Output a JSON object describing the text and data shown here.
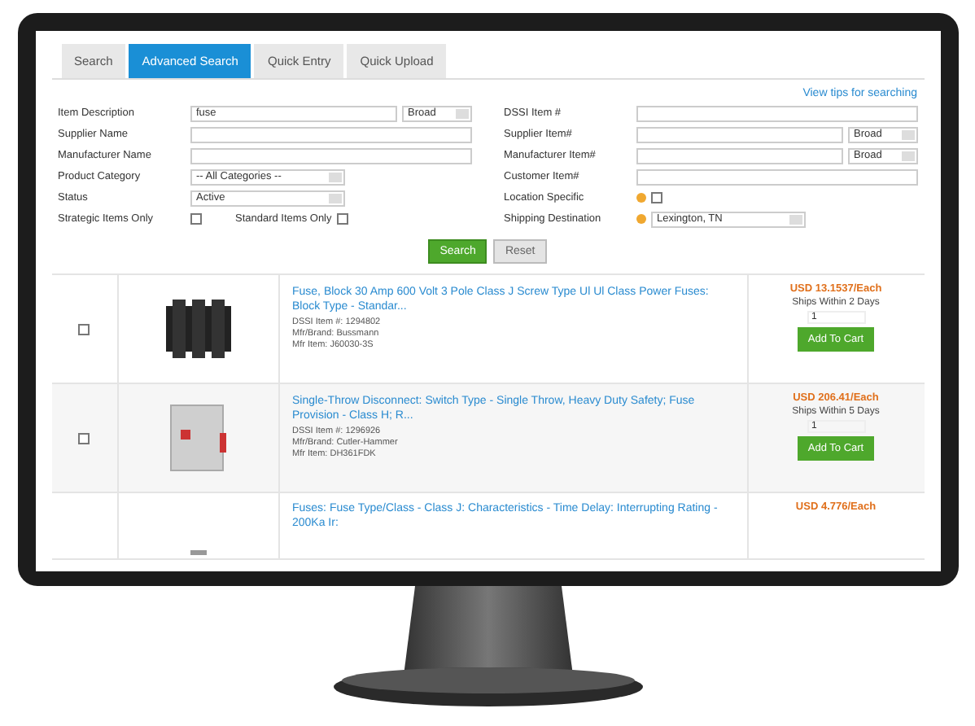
{
  "tabs": [
    {
      "label": "Search",
      "selected": false
    },
    {
      "label": "Advanced Search",
      "selected": true
    },
    {
      "label": "Quick Entry",
      "selected": false
    },
    {
      "label": "Quick Upload",
      "selected": false
    }
  ],
  "tips_link": "View tips for searching",
  "form_left": [
    {
      "kind": "text_select",
      "label": "Item Description",
      "value": "fuse",
      "option": "Broad"
    },
    {
      "kind": "text",
      "label": "Supplier Name"
    },
    {
      "kind": "text",
      "label": "Manufacturer Name"
    },
    {
      "kind": "select",
      "label": "Product Category",
      "option": "-- All Categories --"
    },
    {
      "kind": "select",
      "label": "Status",
      "option": "Active"
    },
    {
      "kind": "checkbox",
      "label": "Strategic Items Only",
      "checked": false,
      "extra_label": "Standard Items Only",
      "extra_checked": false
    }
  ],
  "form_right": [
    {
      "kind": "text",
      "label": "DSSI Item #"
    },
    {
      "kind": "text_select",
      "label": "Supplier Item#",
      "option": "Broad"
    },
    {
      "kind": "text_select",
      "label": "Manufacturer Item#",
      "option": "Broad"
    },
    {
      "kind": "text",
      "label": "Customer Item#"
    },
    {
      "kind": "checkbox",
      "label": "Location Specific",
      "checked": false,
      "help": true
    },
    {
      "kind": "select",
      "label": "Shipping Destination",
      "option": "Lexington, TN",
      "help": true
    }
  ],
  "buttons": [
    {
      "label": "Search",
      "kind": "primary"
    },
    {
      "label": "Reset",
      "kind": "secondary"
    }
  ],
  "results": [
    {
      "checked": false,
      "title": "Fuse, Block 30 Amp 600 Volt 3 Pole Class J Screw Type Ul Ul Class Power Fuses: Block Type - Standar...",
      "details": [
        "DSSI Item #: 1294802",
        "Mfr/Brand: Bussmann",
        "Mfr Item: J60030-3S"
      ],
      "price": "USD 13.1537/Each",
      "ships": "Ships Within 2 Days",
      "qty": "1",
      "cart": "Add To Cart"
    },
    {
      "checked": false,
      "title": "Single-Throw Disconnect: Switch Type - Single Throw, Heavy Duty Safety; Fuse Provision - Class H; R...",
      "details": [
        "DSSI Item #: 1296926",
        "Mfr/Brand: Cutler-Hammer",
        "Mfr Item: DH361FDK"
      ],
      "price": "USD 206.41/Each",
      "ships": "Ships Within 5 Days",
      "qty": "1",
      "cart": "Add To Cart"
    },
    {
      "title": "Fuses: Fuse Type/Class - Class J: Characteristics - Time Delay: Interrupting Rating - 200Ka Ir:",
      "price": "USD 4.776/Each"
    }
  ]
}
